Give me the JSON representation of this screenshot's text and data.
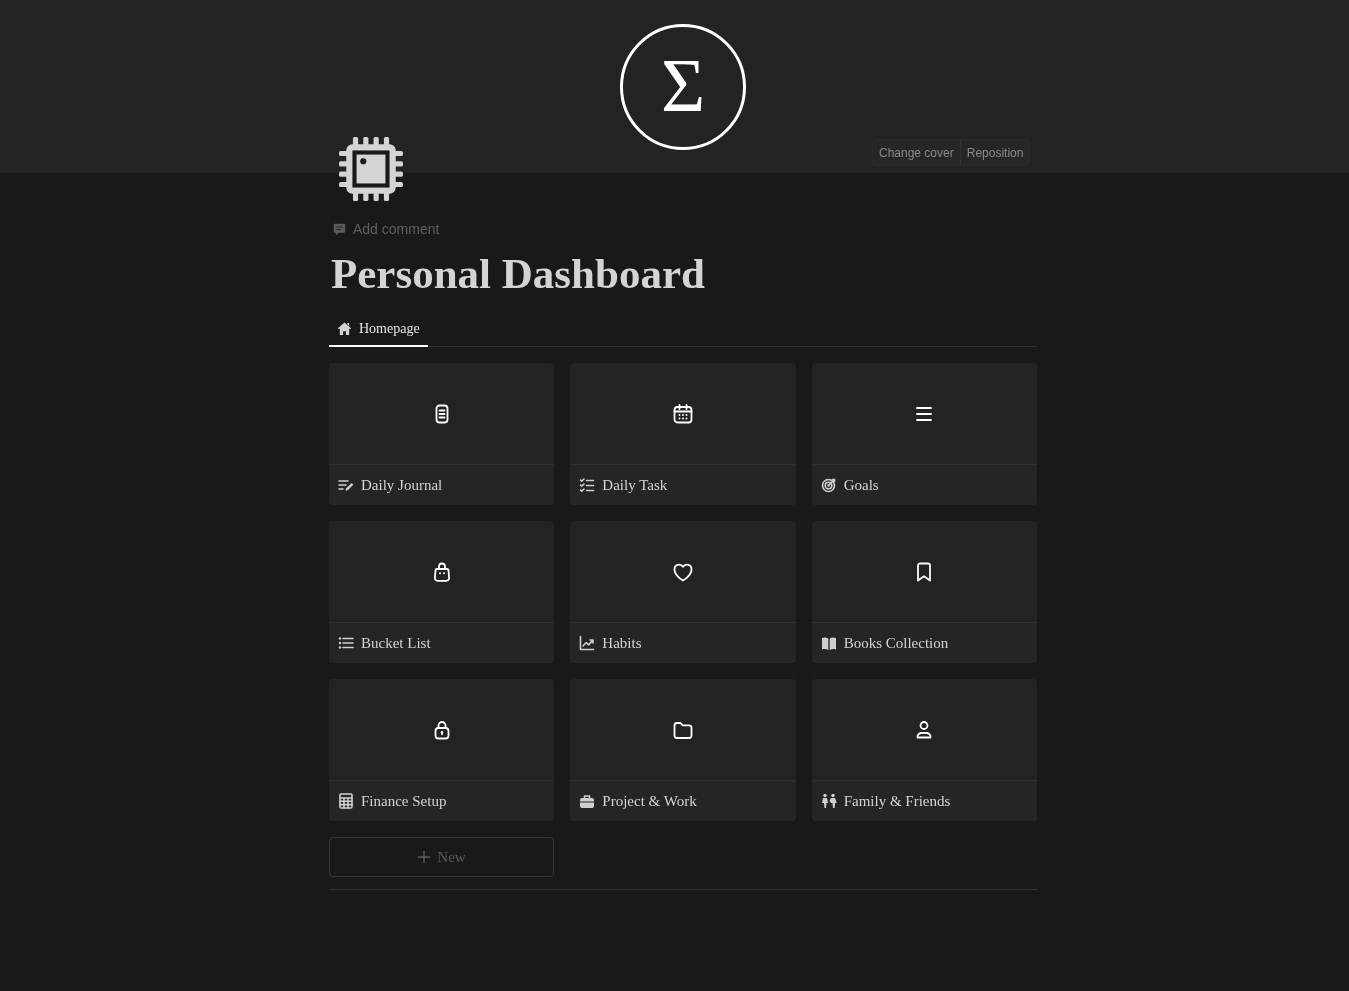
{
  "cover": {
    "logo": "Σ",
    "actions": [
      "Change cover",
      "Reposition"
    ]
  },
  "add_comment": "Add comment",
  "title": "Personal Dashboard",
  "tabs": [
    {
      "label": "Homepage",
      "selected": true
    }
  ],
  "cards": [
    {
      "title": "Daily Journal"
    },
    {
      "title": "Daily Task"
    },
    {
      "title": "Goals"
    },
    {
      "title": "Bucket List"
    },
    {
      "title": "Habits"
    },
    {
      "title": "Books Collection"
    },
    {
      "title": "Finance Setup"
    },
    {
      "title": "Project & Work"
    },
    {
      "title": "Family & Friends"
    }
  ],
  "new_button": "New"
}
